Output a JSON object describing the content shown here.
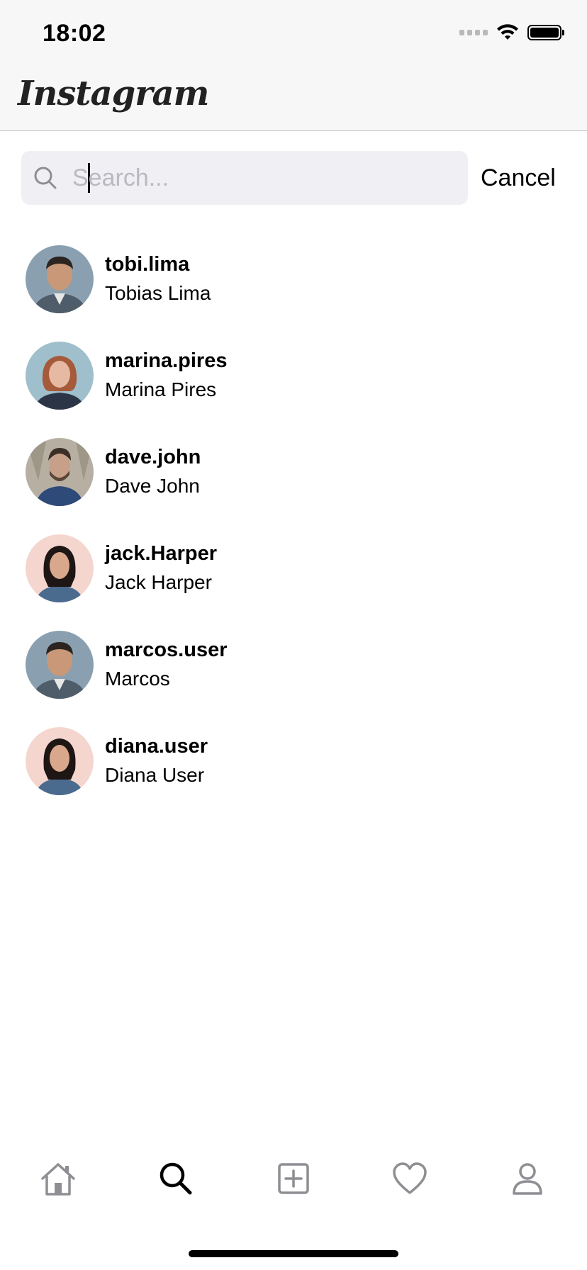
{
  "status_bar": {
    "time": "18:02"
  },
  "header": {
    "app_name": "Instagram"
  },
  "search": {
    "placeholder": "Search...",
    "value": "",
    "cancel_label": "Cancel"
  },
  "results": [
    {
      "username": "tobi.lima",
      "full_name": "Tobias Lima",
      "avatar": "man-blazer"
    },
    {
      "username": "marina.pires",
      "full_name": "Marina Pires",
      "avatar": "woman-redhair"
    },
    {
      "username": "dave.john",
      "full_name": "Dave John",
      "avatar": "man-beard-outdoor"
    },
    {
      "username": "jack.Harper",
      "full_name": "Jack Harper",
      "avatar": "woman-darkhair"
    },
    {
      "username": "marcos.user",
      "full_name": "Marcos",
      "avatar": "man-blazer"
    },
    {
      "username": "diana.user",
      "full_name": "Diana User",
      "avatar": "woman-darkhair"
    }
  ],
  "tab_bar": {
    "tabs": [
      {
        "icon": "home-icon",
        "active": false
      },
      {
        "icon": "search-icon",
        "active": true
      },
      {
        "icon": "add-post-icon",
        "active": false
      },
      {
        "icon": "heart-icon",
        "active": false
      },
      {
        "icon": "profile-icon",
        "active": false
      }
    ]
  },
  "colors": {
    "active_icon": "#000000",
    "inactive_icon": "#8e8e93",
    "search_bg": "#efeff4",
    "placeholder": "#b9b9bf"
  }
}
